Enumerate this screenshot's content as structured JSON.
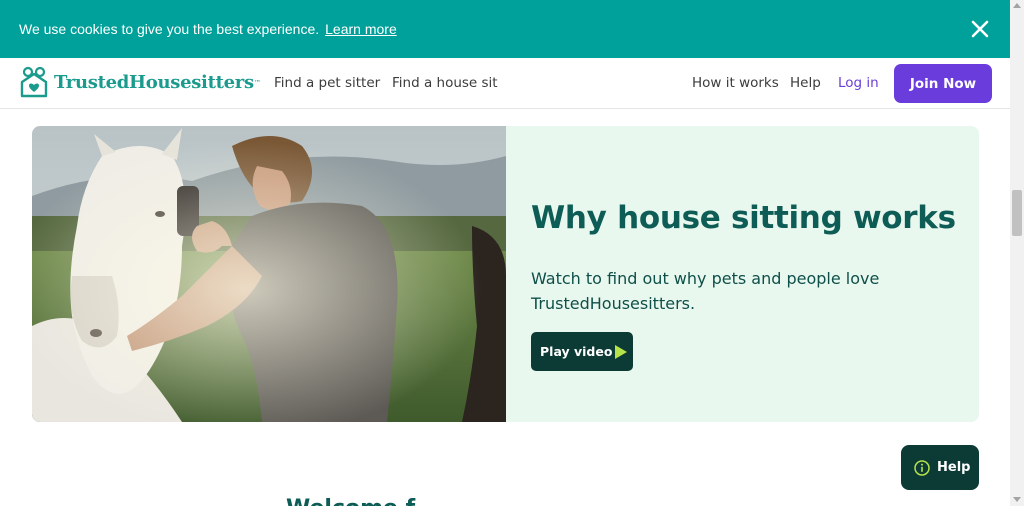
{
  "cookie_banner": {
    "message": "We use cookies to give you the best experience.",
    "link_text": "Learn more",
    "close_icon": "close-icon",
    "background": "#00a19a"
  },
  "header": {
    "logo_text": "TrustedHousesitters",
    "logo_tm": "™",
    "logo_icon": "house-heart-icon",
    "nav_left": [
      "Find a pet sitter",
      "Find a house sit"
    ],
    "nav_right": [
      "How it works",
      "Help",
      "Log in"
    ],
    "join_label": "Join Now",
    "accent": "#6a3cdc"
  },
  "hero": {
    "title": "Why house sitting works",
    "subtitle": "Watch to find out why pets and people love TrustedHousesitters.",
    "play_label": "Play video",
    "play_icon": "play-triangle-icon",
    "image": "man-grooming-white-horse-photo",
    "background": "#e9f8ee"
  },
  "help_widget": {
    "label": "Help",
    "icon": "info-circle-icon"
  },
  "partial_section": {
    "heading": "Welcome f"
  }
}
